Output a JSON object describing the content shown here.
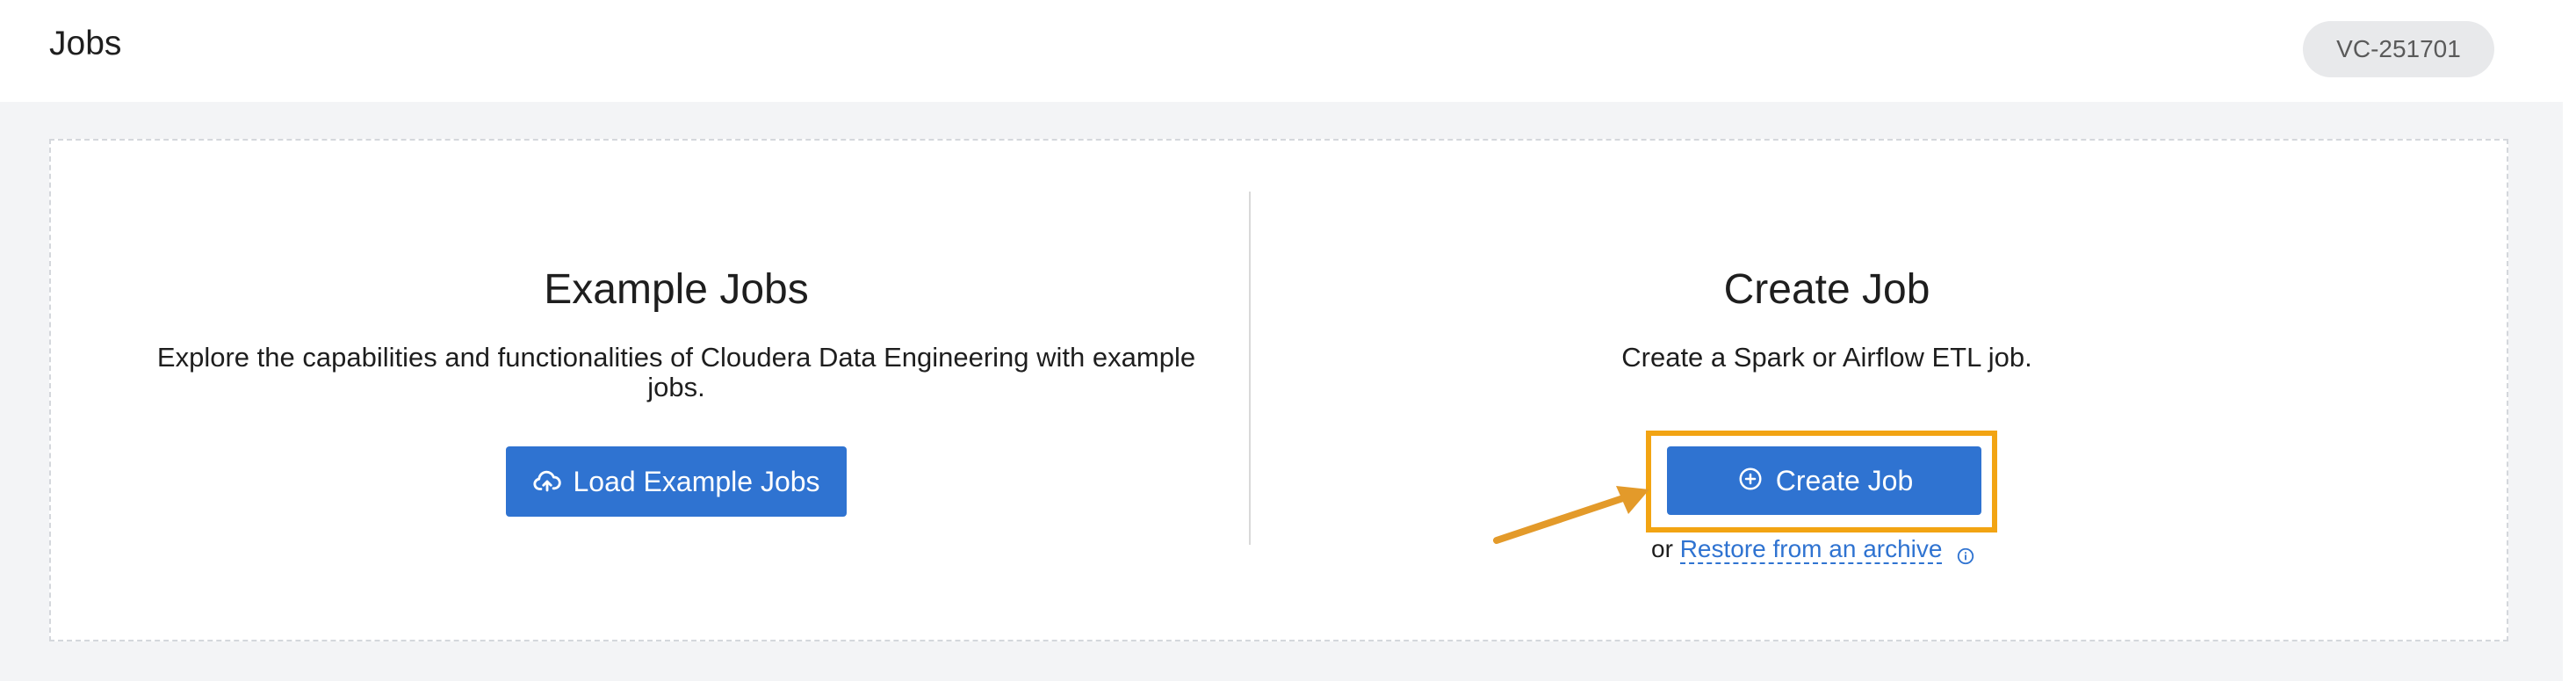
{
  "header": {
    "title": "Jobs",
    "vc_badge": "VC-251701"
  },
  "example_panel": {
    "heading": "Example Jobs",
    "description": "Explore the capabilities and functionalities of Cloudera Data Engineering with example jobs.",
    "button_label": "Load Example Jobs",
    "button_icon": "cloud-upload-icon"
  },
  "create_panel": {
    "heading": "Create Job",
    "description": "Create a Spark or Airflow ETL job.",
    "button_label": "Create Job",
    "button_icon": "plus-circle-icon",
    "or_text": "or",
    "restore_link": "Restore from an archive",
    "info_icon": "info-icon"
  },
  "colors": {
    "primary": "#2f73d1",
    "highlight": "#f2a413",
    "arrow": "#e39a2a",
    "background": "#f3f4f6"
  }
}
